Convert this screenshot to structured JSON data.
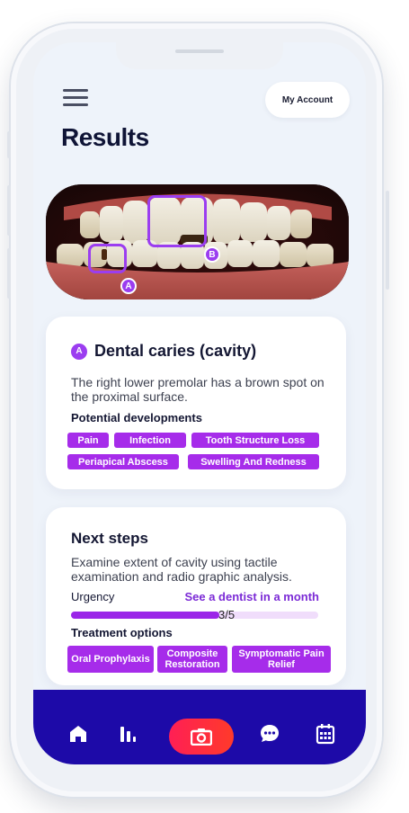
{
  "header": {
    "account_label": "My Account",
    "page_title": "Results"
  },
  "photo": {
    "markers": [
      {
        "label": "A"
      },
      {
        "label": "B"
      }
    ]
  },
  "finding": {
    "marker": "A",
    "title": "Dental caries (cavity)",
    "description": "The right lower premolar has a brown spot on the proximal surface.",
    "developments_heading": "Potential developments",
    "developments": [
      "Pain",
      "Infection",
      "Tooth Structure Loss",
      "Periapical Abscess",
      "Swelling And Redness"
    ]
  },
  "next_steps": {
    "title": "Next steps",
    "description": "Examine extent of cavity using tactile examination and radio graphic analysis.",
    "urgency_label": "Urgency",
    "urgency_value": "See a dentist in a month",
    "urgency_progress": "3/5",
    "urgency_fraction": 0.6,
    "treatment_heading": "Treatment options",
    "treatments": [
      "Oral Prophylaxis",
      "Composite Restoration",
      "Symptomatic Pain Relief"
    ]
  },
  "nav": {
    "items": [
      "home-icon",
      "chart-icon",
      "camera-icon",
      "chat-icon",
      "calendar-icon"
    ]
  },
  "colors": {
    "accent": "#9b3df0",
    "tag": "#a62cea",
    "nav_bar": "#1d0aa8",
    "camera_button": "#ff2a45"
  }
}
